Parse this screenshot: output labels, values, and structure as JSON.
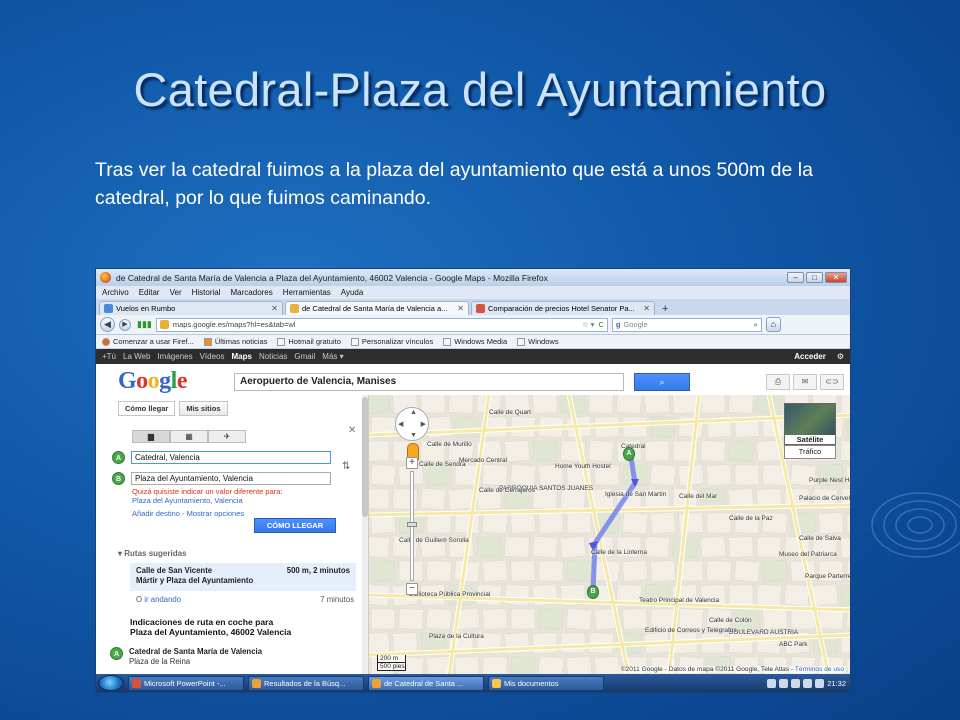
{
  "slide": {
    "title": "Catedral-Plaza del Ayuntamiento",
    "body": "Tras ver la catedral fuimos a la plaza del ayuntamiento que está a unos 500m de la catedral, por lo que fuimos caminando."
  },
  "browser": {
    "window_title": "de Catedral de Santa María de Valencia a Plaza del Ayuntamiento, 46002 Valencia - Google Maps - Mozilla Firefox",
    "menu": [
      "Archivo",
      "Editar",
      "Ver",
      "Historial",
      "Marcadores",
      "Herramientas",
      "Ayuda"
    ],
    "tabs": [
      {
        "label": "Vuelos en Rumbo",
        "active": false
      },
      {
        "label": "de Catedral de Santa María de Valencia a...",
        "active": true
      },
      {
        "label": "Comparación de precios Hotel Senator Pa...",
        "active": false
      }
    ],
    "new_tab": "+",
    "url": "maps.google.es/maps?hl=es&tab=wl",
    "search_placeholder": "Google",
    "bookmarks": [
      "Comenzar a usar Firef...",
      "Últimas noticias",
      "Hotmail gratuito",
      "Personalizar vínculos",
      "Windows Media",
      "Windows"
    ]
  },
  "google_bar": {
    "items": [
      "+Tú",
      "La Web",
      "Imágenes",
      "Vídeos",
      "Maps",
      "Noticias",
      "Gmail",
      "Más ▾"
    ],
    "active": "Maps",
    "login": "Acceder"
  },
  "search": {
    "query": "Aeropuerto de Valencia, Manises"
  },
  "panel": {
    "btn_directions": "Cómo llegar",
    "btn_my_places": "Mis sitios",
    "origin_marker": "A",
    "origin": "Catedral, Valencia",
    "dest_marker": "B",
    "destination": "Plaza del Ayuntamiento, Valencia",
    "warning": "Quizá quisiste indicar un valor diferente para:",
    "warning_link": "Plaza del Ayuntamiento, Valencia",
    "add_links": "Añadir destino - Mostrar opciones",
    "go_button": "CÓMO LLEGAR",
    "suggested_title": "Rutas sugeridas",
    "route_main": "Calle de San Vicente",
    "route_main_stats": "500 m, 2 minutos",
    "route_main_sub": "Mártir y Plaza del Ayuntamiento",
    "route_alt_prefix": "O",
    "route_alt_link": "ir andando",
    "route_alt_time": "7 minutos",
    "directions_head_1": "Indicaciones de ruta en coche para",
    "directions_head_2": "Plaza del Ayuntamiento, 46002 Valencia",
    "step_marker": "A",
    "step_title": "Catedral de Santa María de Valencia",
    "step_sub": "Plaza de la Reina"
  },
  "map": {
    "satellite_label": "Satélite",
    "traffic_label": "Tráfico",
    "pin_a": "A",
    "pin_b": "B",
    "scale_m": "200 m",
    "scale_ft": "500 pies",
    "copyright_text": "©2011 Google - Datos de mapa ©2011 Google, Tele Atlas -",
    "copyright_link": "Términos de uso",
    "labels": [
      "Calle de Quart",
      "Calle de Murillo",
      "Calle de Sendra",
      "Mercado Central",
      "Home Youth Hostel",
      "PARROQUIA SANTOS JUANES",
      "Calle de Cerrajeros",
      "Catedral",
      "Calle de la Paz",
      "Calle del Mar",
      "Iglesia de San Martín",
      "Palacio de Cervelló",
      "Calle de Guillem Sorolla",
      "Calle de la Linterna",
      "Teatro Principal de Valencia",
      "Calle de Colón",
      "BOULEVARD AUSTRIA",
      "Calle de Salva",
      "Biblioteca Pública Provincial",
      "Edificio de Correos y Telégrafos",
      "Parque Parterre",
      "Museo del Patriarca",
      "Purple Nest Hostels",
      "Plaza de la Cultura",
      "ABC Park"
    ]
  },
  "taskbar": {
    "items": [
      {
        "label": "Microsoft PowerPoint -...",
        "active": false
      },
      {
        "label": "Resultados de la Búsq...",
        "active": false
      },
      {
        "label": "de Catedral de Santa ...",
        "active": true
      },
      {
        "label": "Mis documentos",
        "active": false
      }
    ],
    "clock": "21:32"
  }
}
